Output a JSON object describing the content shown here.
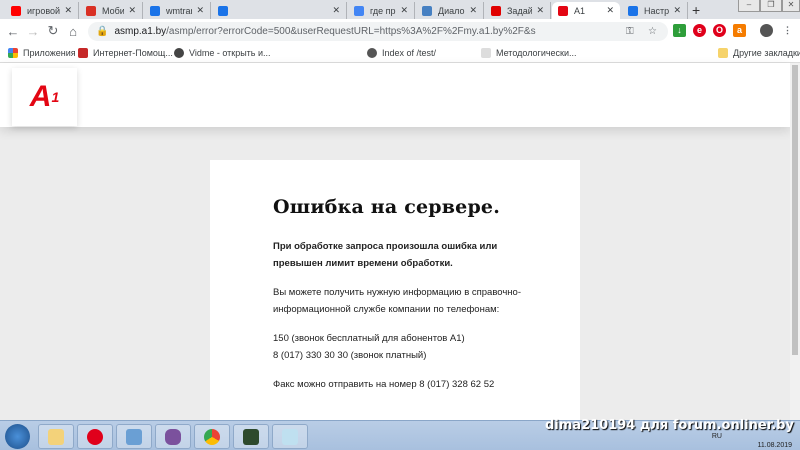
{
  "tabs": [
    {
      "title": "игровой",
      "color": "#ff0000"
    },
    {
      "title": "Мобильн",
      "color": "#d93025"
    },
    {
      "title": "wmtrans",
      "color": "#1a73e8"
    },
    {
      "title": "",
      "color": "#1a73e8"
    },
    {
      "title": "где при",
      "color": "#4285f4"
    },
    {
      "title": "Диалоги",
      "color": "#4680c2"
    },
    {
      "title": "Задай в",
      "color": "#e00000"
    },
    {
      "title": "A1",
      "color": "#e30613"
    },
    {
      "title": "Настрой",
      "color": "#1a73e8"
    }
  ],
  "address": {
    "host": "asmp.a1.by",
    "path": "/asmp/error?errorCode=500&userRequestURL=https%3A%2F%2Fmy.a1.by%2F&s"
  },
  "bookmarks": {
    "apps": "Приложения",
    "items": [
      "Интернет-Помощ...",
      "Vidme - открыть и...",
      "Index of /test/",
      "Методологически..."
    ],
    "other": "Другие закладки"
  },
  "logo": {
    "text": "A",
    "sup": "1"
  },
  "error": {
    "title": "Ошибка на сервере.",
    "lead": "При обработке запроса произошла ошибка или превышен лимит времени обработки.",
    "info": "Вы можете получить нужную информацию в справочно-информационной службе компании по телефонам:",
    "phone1": "150 (звонок бесплатный для абонентов A1)",
    "phone2": "8 (017) 330 30 30 (звонок платный)",
    "fax": "Факс можно отправить на номер 8 (017) 328 62 52"
  },
  "taskbar": {
    "watermark": "dima210194 для forum.onliner.by",
    "lang": "RU",
    "date": "11.08.2019"
  }
}
